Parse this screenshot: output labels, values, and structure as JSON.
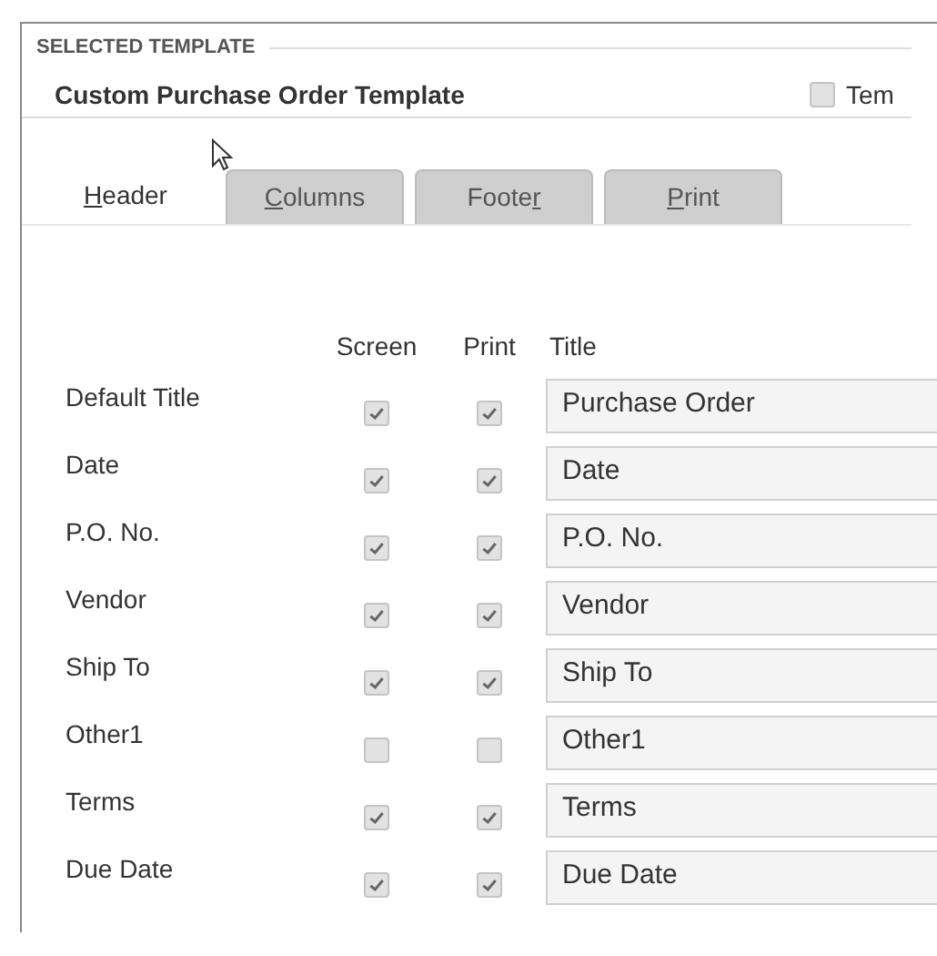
{
  "section_label": "SELECTED TEMPLATE",
  "template_name": "Custom Purchase Order Template",
  "side_option": {
    "label": "Tem",
    "checked": false
  },
  "tabs": [
    {
      "label_parts": [
        {
          "text": "H",
          "underlined": true
        },
        {
          "text": "eader",
          "underlined": false
        }
      ],
      "selected": true
    },
    {
      "label_parts": [
        {
          "text": "C",
          "underlined": true
        },
        {
          "text": "olumns",
          "underlined": false
        }
      ],
      "selected": false
    },
    {
      "label_parts": [
        {
          "text": "Foote",
          "underlined": false
        },
        {
          "text": "r",
          "underlined": true
        }
      ],
      "selected": false
    },
    {
      "label_parts": [
        {
          "text": "P",
          "underlined": true
        },
        {
          "text": "rint",
          "underlined": false
        }
      ],
      "selected": false
    }
  ],
  "columns": [
    "Screen",
    "Print",
    "Title"
  ],
  "rows": [
    {
      "label": "Default Title",
      "screen": true,
      "print": true,
      "title": "Purchase Order"
    },
    {
      "label": "Date",
      "screen": true,
      "print": true,
      "title": "Date"
    },
    {
      "label": "P.O. No.",
      "screen": true,
      "print": true,
      "title": "P.O. No."
    },
    {
      "label": "Vendor",
      "screen": true,
      "print": true,
      "title": "Vendor"
    },
    {
      "label": "Ship To",
      "screen": true,
      "print": true,
      "title": "Ship To"
    },
    {
      "label": "Other1",
      "screen": false,
      "print": false,
      "title": "Other1"
    },
    {
      "label": "Terms",
      "screen": true,
      "print": true,
      "title": "Terms"
    },
    {
      "label": "Due Date",
      "screen": true,
      "print": true,
      "title": "Due Date"
    }
  ]
}
